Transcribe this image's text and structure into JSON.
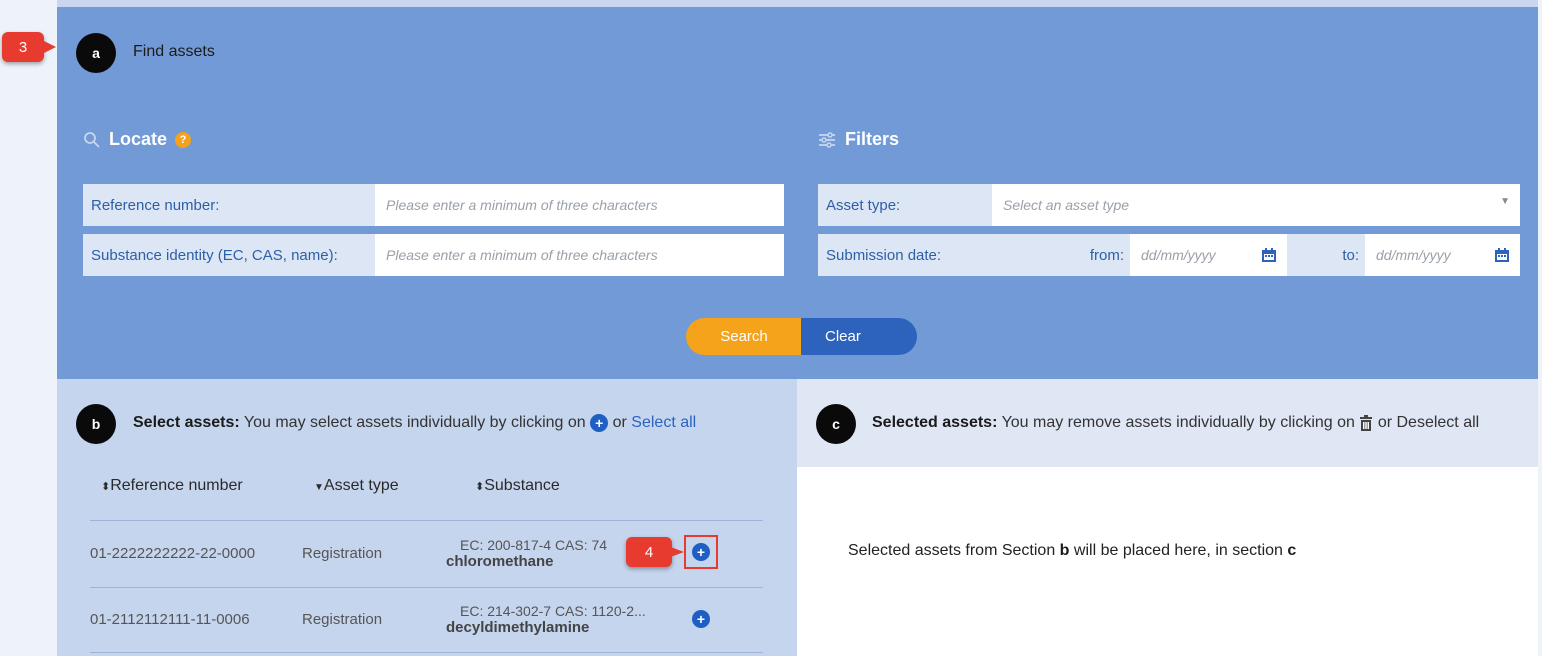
{
  "annotations": {
    "step3": "3",
    "step4": "4"
  },
  "section_a": {
    "badge": "a",
    "title": "Find assets",
    "locate": {
      "title": "Locate",
      "info": "?",
      "reference_label": "Reference number:",
      "reference_placeholder": "Please enter a minimum of three characters",
      "substance_label": "Substance identity (EC, CAS, name):",
      "substance_placeholder": "Please enter a minimum of three characters"
    },
    "filters": {
      "title": "Filters",
      "asset_type_label": "Asset type:",
      "asset_type_value": "Select an asset type",
      "submission_label": "Submission date:",
      "from_label": "from:",
      "from_placeholder": "dd/mm/yyyy",
      "to_label": "to:",
      "to_placeholder": "dd/mm/yyyy"
    },
    "search_label": "Search",
    "clear_label": "Clear"
  },
  "section_b": {
    "badge": "b",
    "title": "Select assets:",
    "text": "You may select assets individually by clicking on",
    "or": "or",
    "select_all": "Select all",
    "columns": [
      "Reference number",
      "Asset type",
      "Substance"
    ],
    "rows": [
      {
        "reference": "01-2222222222-22-0000",
        "type": "Registration",
        "ids": "EC: 200-817-4 CAS: 74",
        "name": "chloromethane"
      },
      {
        "reference": "01-2112112111-11-0006",
        "type": "Registration",
        "ids": "EC: 214-302-7 CAS: 1120-2...",
        "name": "decyldimethylamine"
      }
    ]
  },
  "section_c": {
    "badge": "c",
    "title": "Selected assets:",
    "text": "You may remove assets individually by clicking on",
    "or_deselect": "or Deselect all",
    "placeholder_pre": "Selected assets from Section",
    "placeholder_b": "b",
    "placeholder_mid": "will be placed here, in section",
    "placeholder_c": "c"
  },
  "colors": {
    "header_bg": "#729ad6",
    "panel_b_bg": "#c5d5ee",
    "search": "#f5a31a",
    "clear": "#2e63bd",
    "callout": "#e63b2e"
  },
  "icons": [
    "search-icon",
    "filter-icon",
    "calendar-icon",
    "plus-circle-icon",
    "trash-icon",
    "dropdown-caret-icon",
    "sort-icon"
  ]
}
